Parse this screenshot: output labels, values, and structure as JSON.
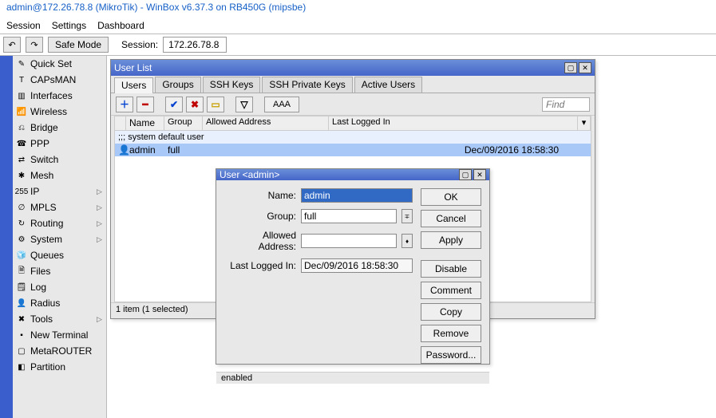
{
  "title": "admin@172.26.78.8 (MikroTik) - WinBox v6.37.3 on RB450G (mipsbe)",
  "menu": {
    "session": "Session",
    "settings": "Settings",
    "dashboard": "Dashboard"
  },
  "toolbar": {
    "safemode": "Safe Mode",
    "session_label": "Session:",
    "session_ip": "172.26.78.8"
  },
  "sidebar": {
    "items": [
      {
        "icon": "✎",
        "label": "Quick Set",
        "arrow": false
      },
      {
        "icon": "T",
        "label": "CAPsMAN",
        "arrow": false
      },
      {
        "icon": "▥",
        "label": "Interfaces",
        "arrow": false
      },
      {
        "icon": "📶",
        "label": "Wireless",
        "arrow": false
      },
      {
        "icon": "⎌",
        "label": "Bridge",
        "arrow": false
      },
      {
        "icon": "☎",
        "label": "PPP",
        "arrow": false
      },
      {
        "icon": "⇄",
        "label": "Switch",
        "arrow": false
      },
      {
        "icon": "✱",
        "label": "Mesh",
        "arrow": false
      },
      {
        "icon": "255",
        "label": "IP",
        "arrow": true
      },
      {
        "icon": "∅",
        "label": "MPLS",
        "arrow": true
      },
      {
        "icon": "↻",
        "label": "Routing",
        "arrow": true
      },
      {
        "icon": "⚙",
        "label": "System",
        "arrow": true
      },
      {
        "icon": "🧊",
        "label": "Queues",
        "arrow": false
      },
      {
        "icon": "🗎",
        "label": "Files",
        "arrow": false
      },
      {
        "icon": "🗒",
        "label": "Log",
        "arrow": false
      },
      {
        "icon": "👤",
        "label": "Radius",
        "arrow": false
      },
      {
        "icon": "✖",
        "label": "Tools",
        "arrow": true
      },
      {
        "icon": "▪",
        "label": "New Terminal",
        "arrow": false
      },
      {
        "icon": "▢",
        "label": "MetaROUTER",
        "arrow": false
      },
      {
        "icon": "◧",
        "label": "Partition",
        "arrow": false
      }
    ]
  },
  "userlist": {
    "title": "User List",
    "tabs": [
      "Users",
      "Groups",
      "SSH Keys",
      "SSH Private Keys",
      "Active Users"
    ],
    "active_tab": 0,
    "aaa": "AAA",
    "find": "Find",
    "columns": {
      "name": "Name",
      "group": "Group",
      "allowed": "Allowed Address",
      "last": "Last Logged In"
    },
    "section": ";;; system default user",
    "row": {
      "name": "admin",
      "group": "full",
      "allowed": "",
      "last": "Dec/09/2016 18:58:30"
    },
    "status": "1 item (1 selected)"
  },
  "userdlg": {
    "title": "User <admin>",
    "labels": {
      "name": "Name:",
      "group": "Group:",
      "allowed": "Allowed Address:",
      "last": "Last Logged In:"
    },
    "values": {
      "name": "admin",
      "group": "full",
      "allowed": "",
      "last": "Dec/09/2016 18:58:30"
    },
    "buttons": {
      "ok": "OK",
      "cancel": "Cancel",
      "apply": "Apply",
      "disable": "Disable",
      "comment": "Comment",
      "copy": "Copy",
      "remove": "Remove",
      "password": "Password..."
    },
    "status": "enabled"
  }
}
